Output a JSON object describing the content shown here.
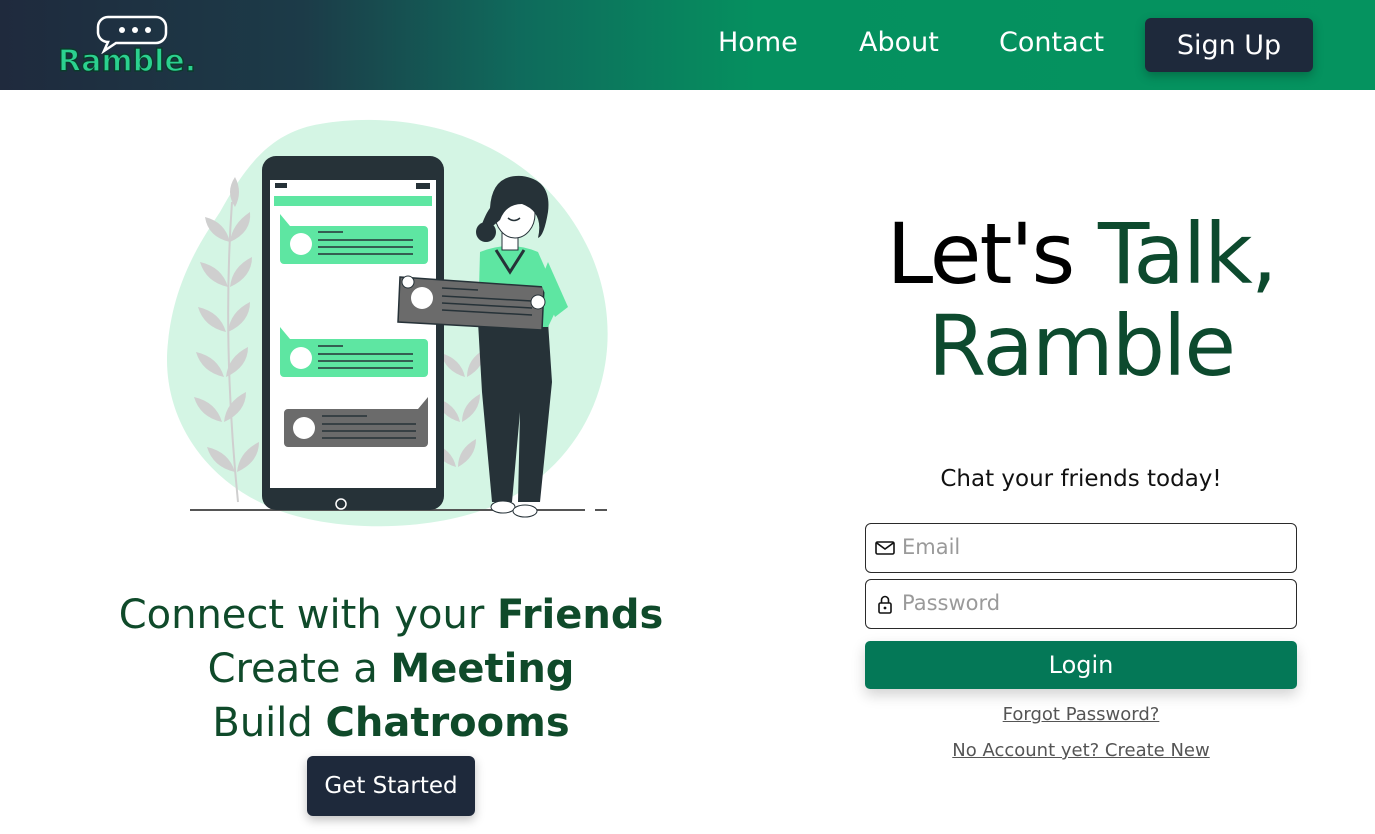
{
  "header": {
    "logo_text": "Ramble.",
    "nav": {
      "home": "Home",
      "about": "About",
      "contact": "Contact"
    },
    "signup_label": "Sign Up"
  },
  "left": {
    "lines": [
      {
        "regular": "Connect with your ",
        "bold": "Friends"
      },
      {
        "regular": "Create a ",
        "bold": "Meeting"
      },
      {
        "regular": "Build ",
        "bold": "Chatrooms"
      }
    ],
    "cta_label": "Get Started"
  },
  "hero": {
    "title_start": "Let's ",
    "title_accent": "Talk,",
    "title_line2": "Ramble",
    "subtitle": "Chat your friends today!"
  },
  "form": {
    "email_placeholder": "Email",
    "email_icon": "envelope-icon",
    "password_placeholder": "Password",
    "password_icon": "lock-icon",
    "login_label": "Login",
    "forgot_label": "Forgot Password?",
    "create_label": "No Account yet? Create New"
  },
  "colors": {
    "brand_green": "#047857",
    "dark_navy": "#1e293b",
    "accent_dark_green": "#0d4a2e",
    "bubble_green": "#5ee6a2"
  }
}
